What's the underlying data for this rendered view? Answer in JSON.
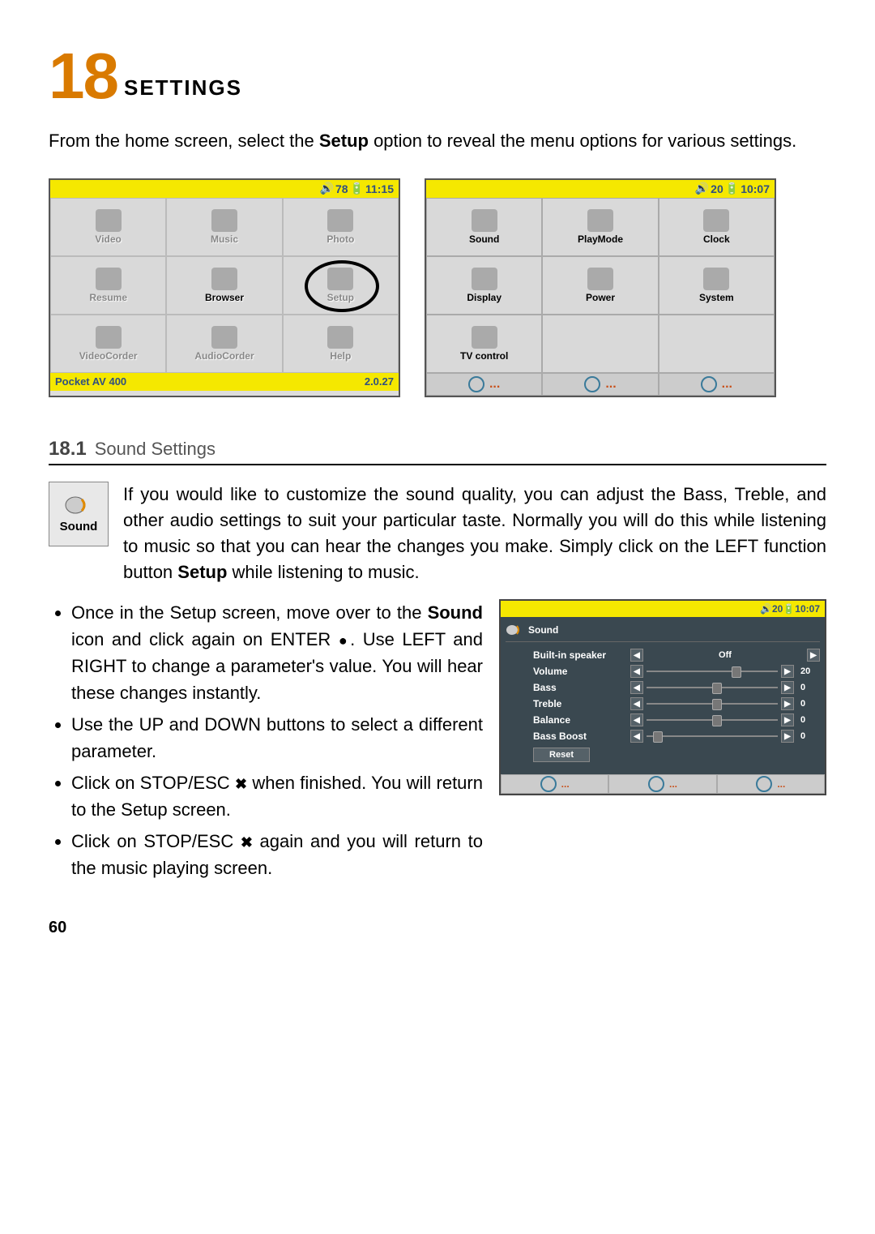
{
  "chapter": {
    "number": "18",
    "title": "SETTINGS"
  },
  "intro": "From the home screen, select the <b>Setup</b> option to reveal the menu options for various settings.",
  "home_screen": {
    "status": {
      "battery": "78",
      "time": "11:15"
    },
    "items": [
      {
        "label": "Video"
      },
      {
        "label": "Music"
      },
      {
        "label": "Photo"
      },
      {
        "label": "Resume"
      },
      {
        "label": "Browser",
        "sel": true
      },
      {
        "label": "Setup",
        "circled": true
      },
      {
        "label": "VideoCorder"
      },
      {
        "label": "AudioCorder"
      },
      {
        "label": "Help"
      }
    ],
    "footer_left": "Pocket AV 400",
    "footer_right": "2.0.27"
  },
  "setup_screen": {
    "status": {
      "battery": "20",
      "time": "10:07"
    },
    "items": [
      {
        "label": "Sound"
      },
      {
        "label": "PlayMode"
      },
      {
        "label": "Clock"
      },
      {
        "label": "Display"
      },
      {
        "label": "Power"
      },
      {
        "label": "System"
      },
      {
        "label": "TV control"
      }
    ]
  },
  "section": {
    "number": "18.1",
    "name": "Sound Settings"
  },
  "sound_icon_label": "Sound",
  "sound_para": "If you would like to customize the sound quality, you can adjust the Bass, Treble, and other audio settings to suit your particular taste. Normally you will do this while listening to music so that you can hear the changes you make. Simply click on the LEFT function button <b>Setup</b> while listening to music.",
  "bullets": [
    "Once in the Setup screen, move over to the <b>Sound</b> icon and click again on ENTER <span class='enter-sym'>●</span>. Use LEFT and RIGHT to change a parameter's value. You will hear these changes instantly.",
    "Use the UP and DOWN buttons to select a different parameter.",
    "Click on STOP/ESC <span class='x-sym'>✖</span> when finished. You will return to the Setup screen.",
    "Click on STOP/ESC <span class='x-sym'>✖</span> again and you will return to the music playing screen."
  ],
  "sound_settings_screen": {
    "status": {
      "battery": "20",
      "time": "10:07"
    },
    "title": "Sound",
    "rows": [
      {
        "label": "Built-in speaker",
        "kind": "toggle",
        "value": "Off"
      },
      {
        "label": "Volume",
        "kind": "slider",
        "value": "20",
        "pos": 65
      },
      {
        "label": "Bass",
        "kind": "slider",
        "value": "0",
        "pos": 50
      },
      {
        "label": "Treble",
        "kind": "slider",
        "value": "0",
        "pos": 50
      },
      {
        "label": "Balance",
        "kind": "slider",
        "value": "0",
        "pos": 50
      },
      {
        "label": "Bass Boost",
        "kind": "slider",
        "value": "0",
        "pos": 5
      }
    ],
    "reset": "Reset"
  },
  "page_number": "60"
}
